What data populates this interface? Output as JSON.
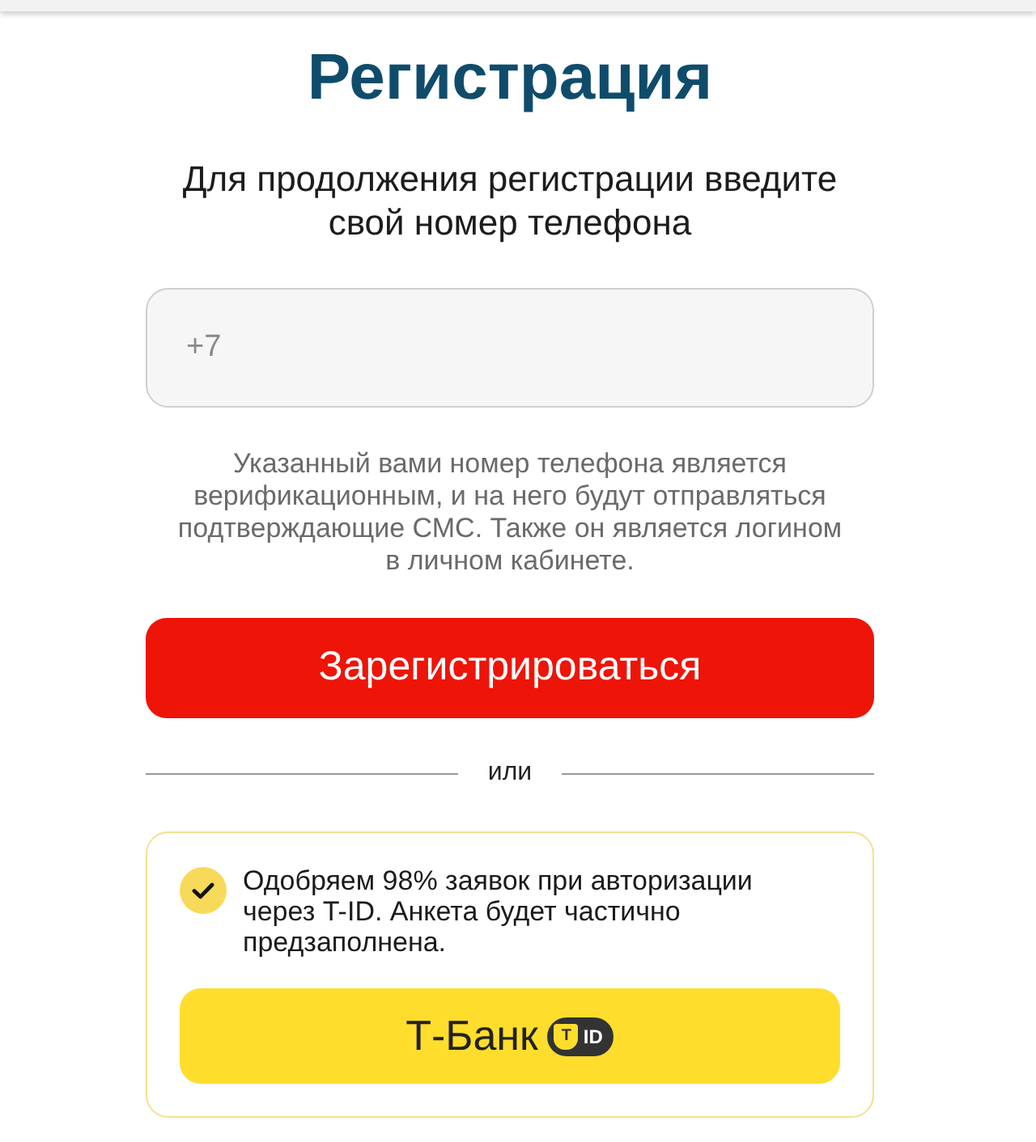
{
  "title": "Регистрация",
  "subtitle": "Для продолжения регистрации введите свой номер телефона",
  "phone_field": {
    "placeholder": "+7"
  },
  "hint": "Указанный вами номер телефона является верификационным, и на него будут отправляться подтверждающие СМС. Также он является логином в личном кабинете.",
  "register_button": "Зарегистрироваться",
  "divider_text": "или",
  "tid_card": {
    "note": "Одобряем 98% заявок при авторизации через T-ID. Анкета будет частично предзаполнена.",
    "button": {
      "label": "Т-Банк",
      "badge_letter": "T",
      "badge_text": "ID"
    }
  }
}
